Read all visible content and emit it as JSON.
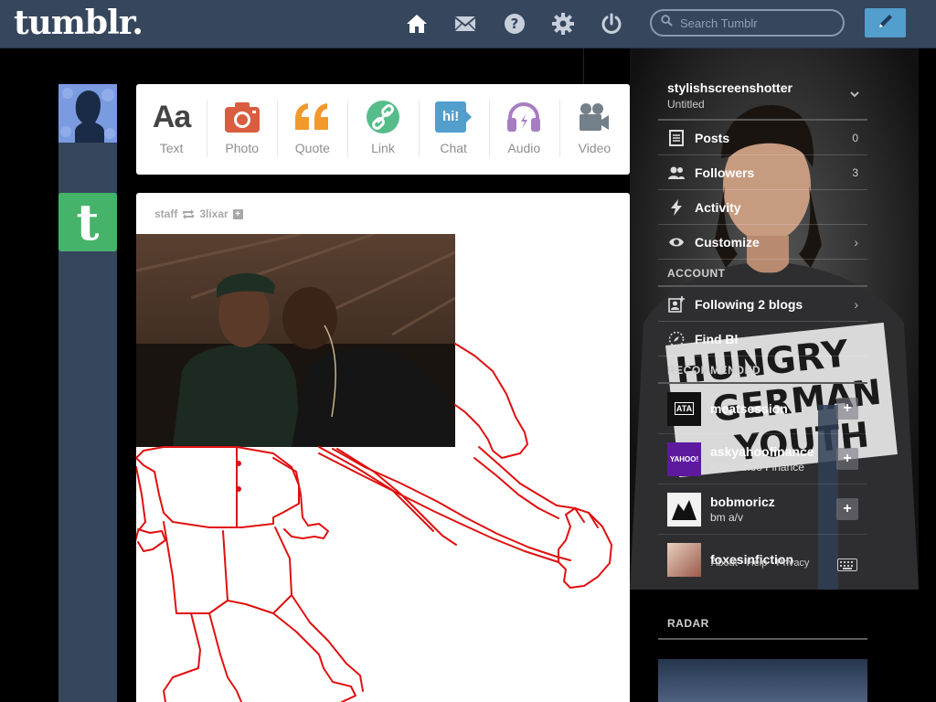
{
  "header": {
    "logo": "tumblr.",
    "nav": [
      "home-icon",
      "mail-icon",
      "help-icon",
      "gear-icon",
      "power-icon"
    ],
    "search_placeholder": "Search Tumblr",
    "compose_icon": "pencil-icon"
  },
  "post_types": [
    {
      "label": "Text",
      "glyph": "Aa",
      "color": "#444444"
    },
    {
      "label": "Photo",
      "color": "#d95e40"
    },
    {
      "label": "Quote",
      "glyph": "❛❛",
      "color": "#f2992e"
    },
    {
      "label": "Link",
      "color": "#56bc8a"
    },
    {
      "label": "Chat",
      "glyph": "hi!",
      "color": "#529ecc"
    },
    {
      "label": "Audio",
      "color": "#a77dc2"
    },
    {
      "label": "Video",
      "color": "#748089"
    }
  ],
  "post": {
    "author": "staff",
    "reblogged_from": "3lixar",
    "follow_glyph": "+"
  },
  "staff_avatar_glyph": "t",
  "sidebar": {
    "blog_name": "stylishscreenshotter",
    "blog_subtitle": "Untitled",
    "rows": [
      {
        "label": "Posts",
        "count": "0",
        "icon": "posts-icon"
      },
      {
        "label": "Followers",
        "count": "3",
        "icon": "followers-icon"
      },
      {
        "label": "Activity",
        "count": "",
        "icon": "activity-icon"
      },
      {
        "label": "Customize",
        "count": "",
        "icon": "eye-icon",
        "chevron": "›"
      }
    ],
    "account_title": "ACCOUNT",
    "account_rows": [
      {
        "label": "Following 2 blogs",
        "icon": "following-icon",
        "chevron": "›"
      },
      {
        "label": "Find Bl",
        "icon": "compass-icon"
      }
    ],
    "recommended_title": "RECOMMENDED",
    "recommended": [
      {
        "name": "meatsession",
        "desc": "",
        "thumb_text": "ATA",
        "thumb_color": "#111111"
      },
      {
        "name": "askyahoofinance",
        "desc": "Ask Yahoo Finance",
        "thumb_text": "YAHOO!",
        "thumb_color": "#5d1a9e"
      },
      {
        "name": "bobmoricz",
        "desc": "bm a/v",
        "thumb_text": "",
        "thumb_color": "#f2f2f2"
      },
      {
        "name": "foxesinfiction",
        "desc": "",
        "thumb_text": "",
        "thumb_color": "#caa090"
      }
    ],
    "footer": [
      "About",
      "Help",
      "Privacy"
    ],
    "radar_title": "RADAR",
    "shirt_text": [
      "HUNGRY",
      "GERMAN",
      "YOUTH"
    ]
  },
  "colors": {
    "navy": "#36465d",
    "accent_blue": "#529ecc",
    "staff_green": "#46b36a",
    "drawing_red": "#e01010"
  }
}
